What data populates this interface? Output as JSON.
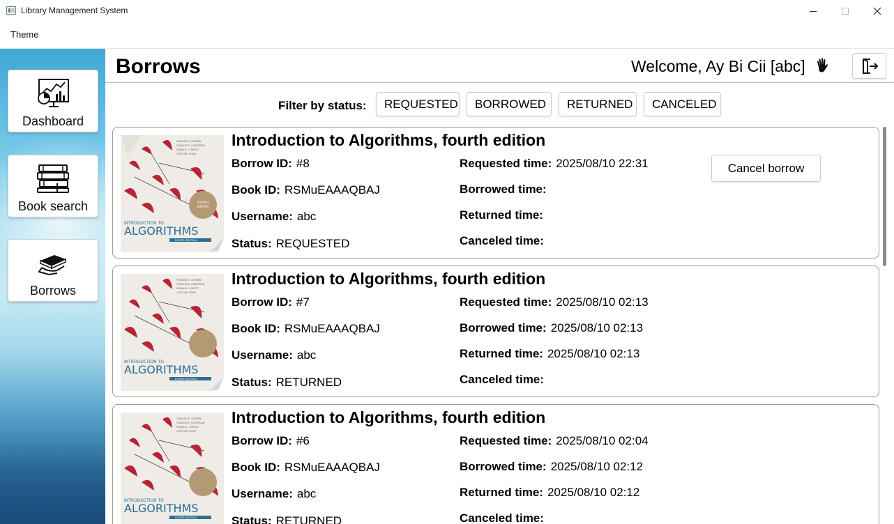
{
  "window": {
    "title": "Library Management System"
  },
  "menu": {
    "items": [
      "Theme"
    ]
  },
  "sidebar": {
    "items": [
      {
        "label": "Dashboard",
        "icon": "dashboard-chart-icon"
      },
      {
        "label": "Book search",
        "icon": "books-stack-icon"
      },
      {
        "label": "Borrows",
        "icon": "hand-book-icon"
      }
    ]
  },
  "header": {
    "title": "Borrows",
    "welcome": "Welcome, Ay Bi Cii [abc]",
    "wave_icon": "waving-hand-icon",
    "logout_icon": "logout-icon"
  },
  "filter": {
    "label": "Filter by status:",
    "options": [
      "REQUESTED",
      "BORROWED",
      "RETURNED",
      "CANCELED"
    ]
  },
  "labels": {
    "borrow_id": "Borrow ID:",
    "book_id": "Book ID:",
    "username": "Username:",
    "status": "Status:",
    "requested_time": "Requested time:",
    "borrowed_time": "Borrowed time:",
    "returned_time": "Returned time:",
    "canceled_time": "Canceled time:",
    "cancel_borrow": "Cancel borrow"
  },
  "cover": {
    "authors": [
      "THOMAS H. CORMEN",
      "CHARLES E. LEISERSON",
      "RONALD L. RIVEST",
      "CLIFFORD STEIN"
    ],
    "intro": "INTRODUCTION TO",
    "title": "ALGORITHMS",
    "edition": "FOURTH EDITION"
  },
  "borrows": [
    {
      "title": "Introduction to Algorithms, fourth edition",
      "borrow_id": "#8",
      "book_id": "RSMuEAAAQBAJ",
      "username": "abc",
      "status": "REQUESTED",
      "requested_time": "2025/08/10 22:31",
      "borrowed_time": "",
      "returned_time": "",
      "canceled_time": ""
    },
    {
      "title": "Introduction to Algorithms, fourth edition",
      "borrow_id": "#7",
      "book_id": "RSMuEAAAQBAJ",
      "username": "abc",
      "status": "RETURNED",
      "requested_time": "2025/08/10 02:13",
      "borrowed_time": "2025/08/10 02:13",
      "returned_time": "2025/08/10 02:13",
      "canceled_time": ""
    },
    {
      "title": "Introduction to Algorithms, fourth edition",
      "borrow_id": "#6",
      "book_id": "RSMuEAAAQBAJ",
      "username": "abc",
      "status": "RETURNED",
      "requested_time": "2025/08/10 02:04",
      "borrowed_time": "2025/08/10 02:12",
      "returned_time": "2025/08/10 02:12",
      "canceled_time": ""
    }
  ]
}
